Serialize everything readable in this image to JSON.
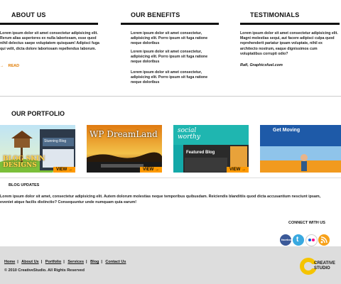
{
  "about": {
    "title": "ABOUT US",
    "text": "Lorem ipsum dolor sit amet consectetur adipisicing elit. Rerum alias asperiores ex nulla laboriosam, esse quod nihil delectus saepe voluptatem quisquam! Adipisci fuga qui velit, dicta dolore laboriosam repellendus laborum.",
    "read_label": "READ"
  },
  "benefits": {
    "title": "OUR BENEFITS",
    "items": [
      "Lorem ipsum dolor sit amet consectetur, adipisicing elit. Porro ipsum sit fuga ratione neque doloribus",
      "Lorem ipsum dolor sit amet consectetur, adipisicing elit. Porro ipsum sit fuga ratione neque doloribus",
      "Lorem ipsum dolor sit amet consectetur, adipisicing elit. Porro ipsum sit fuga ratione neque doloribus"
    ]
  },
  "testimonials": {
    "title": "TESTIMONIALS",
    "text": "Lorem ipsum dolor sit amet consectetur adipisicing elit. Magni molestias sequi, aut facere adipisci culpa quod reprehenderit pariatur ipsam voluptate, nihil ex architecto nostrum, eaque dignissimos cum voluptatibus corrupti odio?",
    "author": "Rafi, Graphicsfuel.com"
  },
  "portfolio": {
    "title": "OUR PORTFOLIO",
    "items": [
      {
        "caption": "BLOG SKIN DESIGNS",
        "side_text": "Stunning Blog",
        "view_label": "VIEW →"
      },
      {
        "caption": "WP DreamLand",
        "side_text": "",
        "view_label": "VIEW →"
      },
      {
        "caption": "social worthy",
        "side_text": "Featured Blog",
        "view_label": "VIEW →"
      },
      {
        "caption": "Get Moving",
        "side_text": "",
        "view_label": ""
      }
    ]
  },
  "blog": {
    "title": "BLOG UPDATES",
    "text": "Lorem ipsum dolor sit amet, consectetur adipisicing elit. Autem dolorum molestias neque temporibus quibusdam. Reiciendis blanditiis quod dicta accusantium nesciunt ipsam, eveniet atque facilis distinctio? Consequuntur unde numquam quia earum!"
  },
  "connect": {
    "title": "CONNECT WITH US",
    "icons": [
      "facebook-icon",
      "twitter-icon",
      "flickr-icon",
      "rss-icon"
    ],
    "colors": [
      "#3b5998",
      "#39a9e0",
      "#ffffff",
      "#f7a11a"
    ]
  },
  "footer": {
    "links": [
      "Home",
      "About Us",
      "Portfolio",
      "Services",
      "Blog",
      "Contact Us"
    ],
    "copyright": "© 2010 CreativeStudio. All Rights Reserved",
    "logo_line1": "CREATIVE",
    "logo_line2": "STUDIO"
  },
  "colors": {
    "accent": "#ff9a00",
    "footer_bg": "#dddddd"
  }
}
